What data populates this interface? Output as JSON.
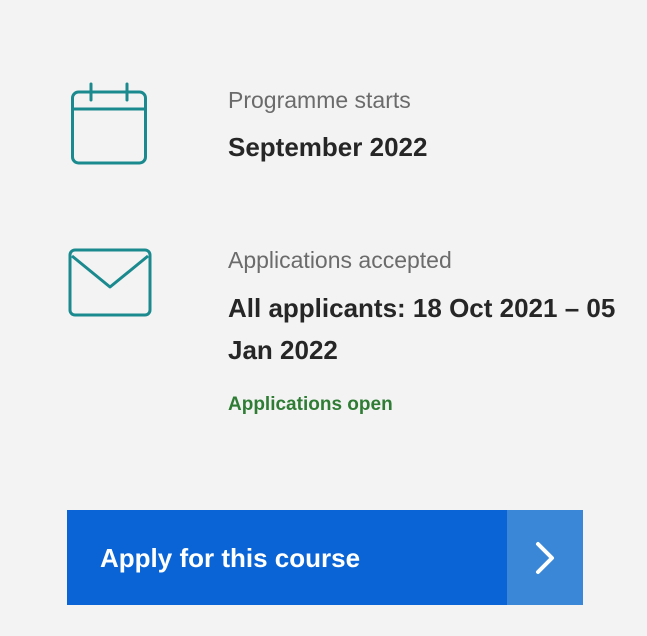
{
  "programme_start": {
    "icon": "calendar-icon",
    "label": "Programme starts",
    "value": "September 2022"
  },
  "applications": {
    "icon": "mail-icon",
    "label": "Applications accepted",
    "value": "All applicants: 18 Oct 2021 – 05 Jan 2022",
    "status": "Applications open"
  },
  "apply_button": {
    "label": "Apply for this course",
    "icon": "chevron-right-icon"
  },
  "colors": {
    "background": "#f3f3f3",
    "icon_teal": "#1a8a8f",
    "status_green": "#2f7d35",
    "button_blue": "#0a64d6",
    "button_arrow_blue": "#3a87d8"
  }
}
